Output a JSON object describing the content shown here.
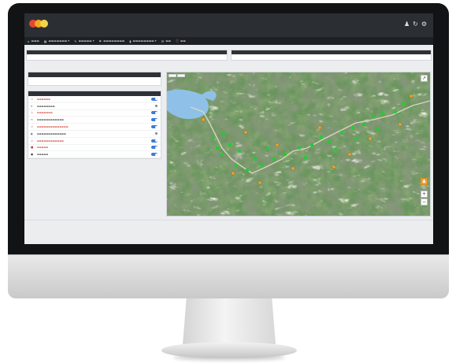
{
  "app": {
    "brand_colors": [
      "#e9452f",
      "#f4a91c",
      "#f1d44a"
    ],
    "accent_color": "#3a7bd5",
    "alert_color": "#d33a2c",
    "header_icons": [
      "user-icon",
      "refresh-icon",
      "gear-icon"
    ]
  },
  "nav": {
    "items": [
      {
        "icon": "home-icon"
      },
      {
        "icon": "grid-icon"
      },
      {
        "icon": "edit-icon"
      },
      {
        "icon": "tag-icon"
      },
      {
        "icon": "chart-icon"
      },
      {
        "icon": "wrench-icon"
      },
      {
        "icon": "info-icon"
      }
    ]
  },
  "filters": [
    {
      "header": "",
      "value": ""
    },
    {
      "header": "",
      "value": ""
    }
  ],
  "panels": {
    "search": {
      "header": ""
    },
    "layers": {
      "header": "",
      "items": [
        {
          "icon": "warning-icon",
          "alert": true,
          "on": true
        },
        {
          "icon": "road-icon",
          "alert": false,
          "on": false
        },
        {
          "icon": "warning-icon",
          "alert": true,
          "on": true
        },
        {
          "icon": "bridge-icon",
          "alert": false,
          "on": true
        },
        {
          "icon": "warning-icon",
          "alert": true,
          "on": true
        },
        {
          "icon": "tunnel-icon",
          "alert": false,
          "on": false
        },
        {
          "icon": "warning-icon",
          "alert": true,
          "on": true
        },
        {
          "icon": "barrier-icon",
          "alert": true,
          "on": true
        },
        {
          "icon": "pin-icon",
          "alert": false,
          "on": true
        }
      ]
    }
  },
  "map": {
    "tabs": [
      "",
      ""
    ],
    "controls": [
      "zoom-in-icon",
      "zoom-out-icon",
      "expand-icon",
      "person-icon"
    ]
  },
  "footer": {
    "left": "",
    "right": ""
  }
}
